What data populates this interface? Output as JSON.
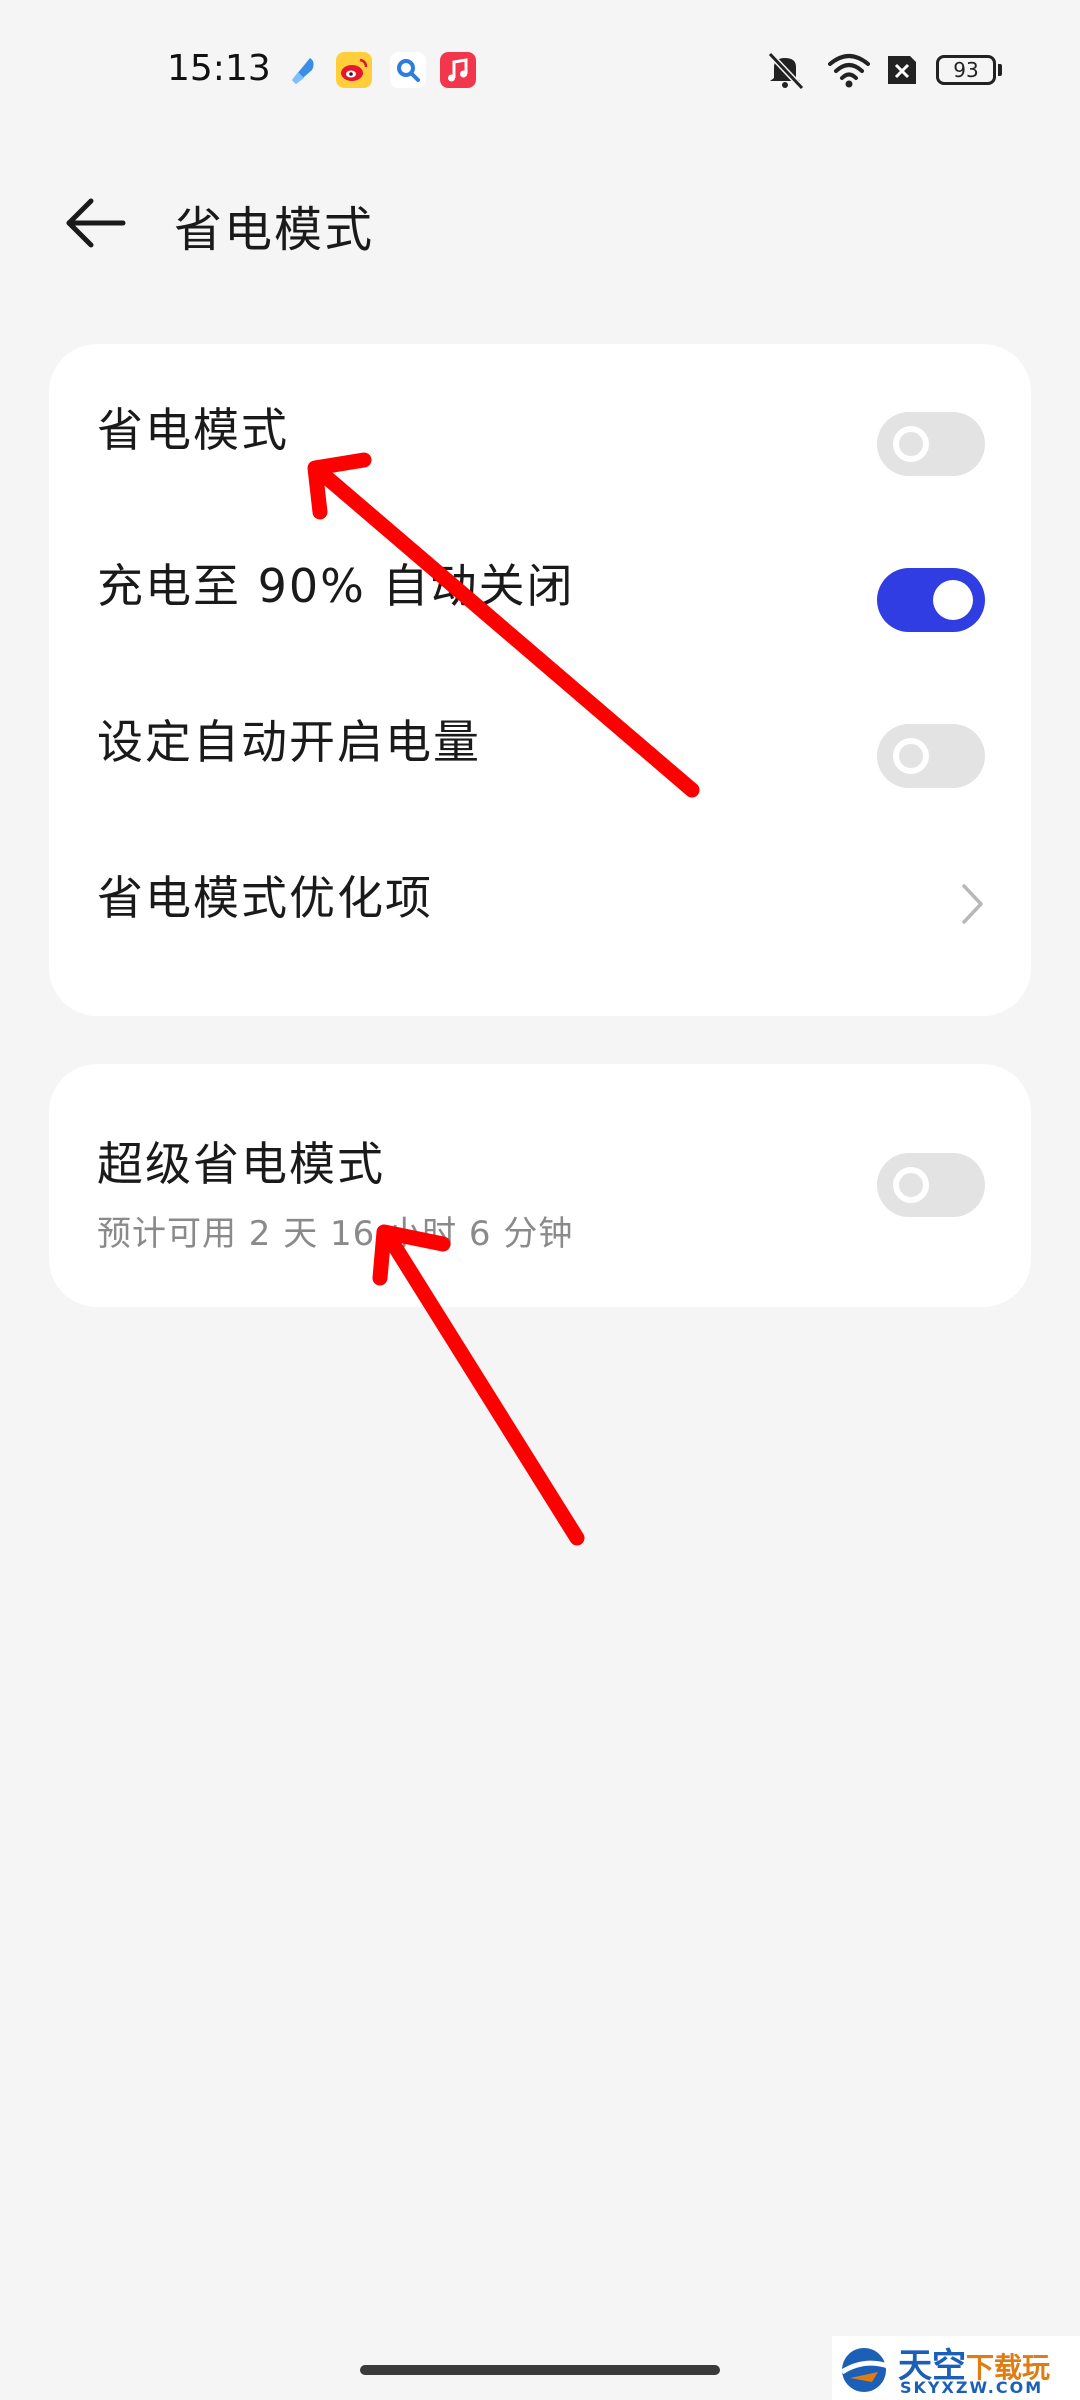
{
  "status_bar": {
    "time": "15:13",
    "app_icons": [
      "blue-app-icon",
      "weibo-icon",
      "search-app-icon",
      "music-icon"
    ],
    "right_icons": [
      "mute-icon",
      "wifi-icon",
      "no-sim-icon"
    ],
    "battery_level": "93"
  },
  "header": {
    "title": "省电模式",
    "back_icon": "arrow-left-icon"
  },
  "settings": {
    "power_saving": {
      "label": "省电模式",
      "enabled": false
    },
    "auto_off_90": {
      "label": "充电至 90% 自动关闭",
      "enabled": true
    },
    "auto_on_level": {
      "label": "设定自动开启电量",
      "enabled": false
    },
    "optimization": {
      "label": "省电模式优化项",
      "icon": "chevron-right-icon"
    }
  },
  "super_saver": {
    "label": "超级省电模式",
    "subtitle": "预计可用 2 天 16 小时 6 分钟",
    "enabled": false
  },
  "colors": {
    "accent": "#2f3de2",
    "toggle_off": "#e3e3e3",
    "background": "#f5f5f5",
    "card": "#ffffff",
    "annotation_arrow": "#ff0000"
  },
  "watermark": {
    "name_main": "天空",
    "name_accent": "下载玩",
    "domain": "SKYXZW.COM"
  }
}
